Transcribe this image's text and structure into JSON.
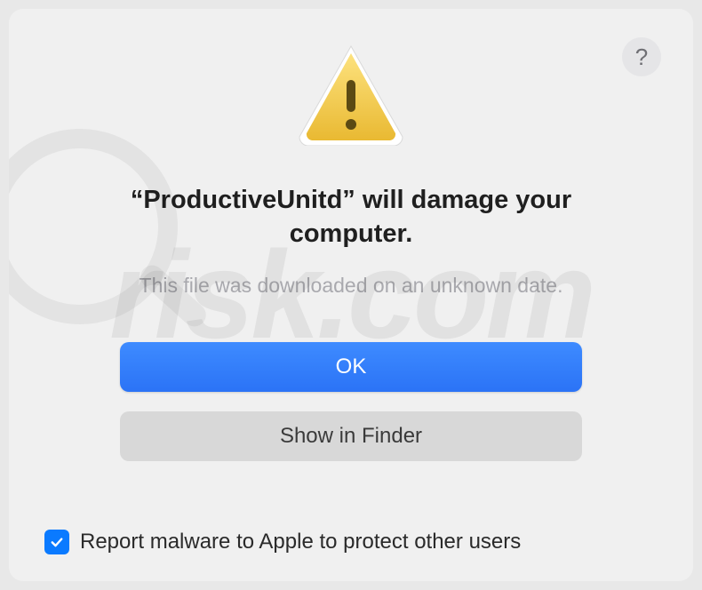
{
  "dialog": {
    "title": "“ProductiveUnitd” will damage your computer.",
    "subtitle": "This file was downloaded on an unknown date.",
    "primary_button": "OK",
    "secondary_button": "Show in Finder",
    "checkbox_label": "Report malware to Apple to protect other users",
    "checkbox_checked": true,
    "help_label": "?"
  },
  "icons": {
    "warning": "warning-triangle",
    "help": "help-circle",
    "checkmark": "checkmark"
  },
  "colors": {
    "primary_button_bg": "#2b73f6",
    "checkbox_bg": "#0a7aff",
    "dialog_bg": "#f0f0f0"
  }
}
